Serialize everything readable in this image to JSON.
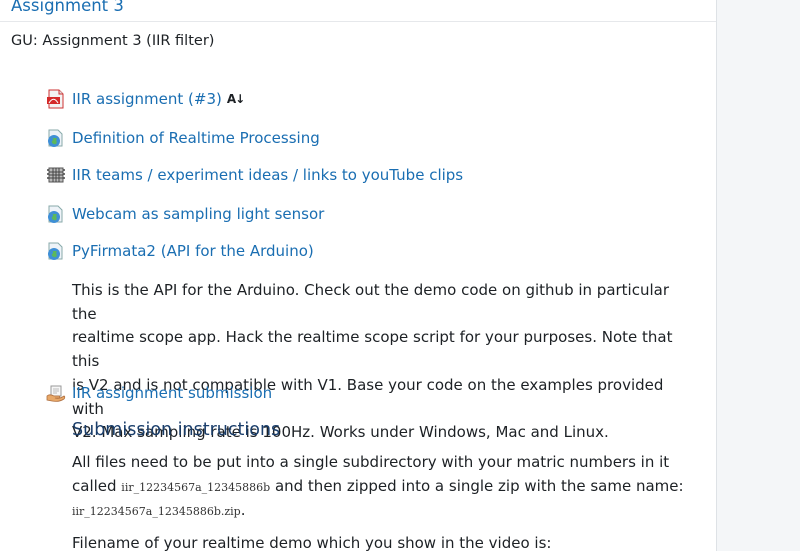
{
  "section": {
    "title": "Assignment 3",
    "summary": "GU: Assignment 3 (IIR filter)"
  },
  "activities": [
    {
      "label": "IIR assignment (#3)",
      "icon": "pdf-icon",
      "badge": "A↓"
    },
    {
      "label": "Definition of Realtime Processing",
      "icon": "url-icon"
    },
    {
      "label": "IIR teams / experiment ideas / links to youTube clips",
      "icon": "wiki-icon"
    },
    {
      "label": "Webcam as sampling light sensor",
      "icon": "url-icon"
    },
    {
      "label": "PyFirmata2 (API for the Arduino)",
      "icon": "url-icon"
    },
    {
      "label": "IIR assignment submission",
      "icon": "assignment-icon"
    }
  ],
  "pyfirmata_description": [
    "This is the API for the Arduino. Check out the demo code on github in particular the",
    "realtime scope app. Hack the realtime scope script for your purposes. Note that this",
    "is V2 and is not compatible with V1. Base your code on the examples provided with",
    "V2. Max sampling rate is 100Hz. Works under Windows, Mac and Linux."
  ],
  "submission": {
    "heading": "Submission instructions",
    "line1": "All files need to be put into a single subdirectory with your matric numbers in it",
    "line2_pre": "called ",
    "code1": "iir_12234567a_12345886b",
    "line2_post": " and then zipped into a single zip with the same name:",
    "code2": "iir_12234567a_12345886b.zip",
    "line3_post": ".",
    "line4": "Filename of your realtime demo which you show in the video is:"
  },
  "colors": {
    "link": "#1a6eb2",
    "text": "#1d2125",
    "sidebar": "#f4f6f8"
  }
}
